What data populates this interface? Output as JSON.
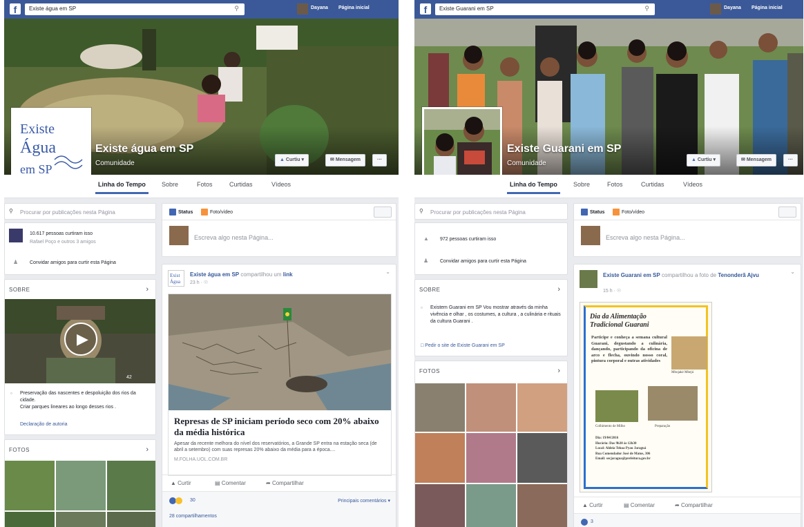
{
  "left": {
    "search_value": "Existe água em SP",
    "user_name": "Dayana",
    "home_label": "Página inicial",
    "page_name": "Existe água em SP",
    "category": "Comunidade",
    "logo_text": "Existe Água em SP",
    "like_button": "Curtiu ▾",
    "message_button": "Mensagem",
    "more_button": "···",
    "tabs": [
      "Linha do Tempo",
      "Sobre",
      "Fotos",
      "Curtidas",
      "Vídeos"
    ],
    "search_posts_placeholder": "Procurar por publicações nesta Página",
    "likes_count": "10.617 pessoas curtiram isso",
    "likes_friends": "Rafael Poço e outros 3 amigos",
    "invite_text": "Convidar amigos para curtir esta Página",
    "about_header": "SOBRE",
    "video_views": "42",
    "about_text_1": "Preservação das nascentes e despoluição dos rios da cidade.",
    "about_text_2": "Criar parques lineares ao longo desses rios .",
    "declaration_link": "Declaração de autoria",
    "photos_header": "FOTOS",
    "composer_status": "Status",
    "composer_photo": "Foto/vídeo",
    "composer_placeholder": "Escreva algo nesta Página...",
    "post_author": "Existe água em SP",
    "post_action": "compartilhou um",
    "post_link_word": "link",
    "post_time": "23 h · ",
    "article_title": "Represas de SP iniciam período seco com 20% abaixo da média histórica",
    "article_desc": "Apesar da recente melhora do nível dos reservatórios, a Grande SP entra na estação seca (de abril a setembro) com suas represas 20% abaixo da média para a época....",
    "article_source": "M.FOLHA.UOL.COM.BR",
    "like_action": "Curtir",
    "comment_action": "Comentar",
    "share_action": "Compartilhar",
    "reactions_count": "30",
    "top_comments": "Principais comentários ▾",
    "shares_count": "28 compartilhamentos"
  },
  "right": {
    "search_value": "Existe Guarani em SP",
    "user_name": "Dayana",
    "home_label": "Página inicial",
    "page_name": "Existe Guarani em SP",
    "category": "Comunidade",
    "like_button": "Curtiu ▾",
    "message_button": "Mensagem",
    "more_button": "···",
    "tabs": [
      "Linha do Tempo",
      "Sobre",
      "Fotos",
      "Curtidas",
      "Vídeos"
    ],
    "search_posts_placeholder": "Procurar por publicações nesta Página",
    "likes_count": "972 pessoas curtiram isso",
    "invite_text": "Convidar amigos para curtir esta Página",
    "about_header": "SOBRE",
    "about_text": "Existem Guarani em SP Vou mostrar através da minha vivência e olhar , os costumes, a cultura , a culinária e rituais da cultura Guarani .",
    "suggest_link": "Pedir o site de Existe Guarani em SP",
    "photos_header": "FOTOS",
    "composer_status": "Status",
    "composer_photo": "Foto/vídeo",
    "composer_placeholder": "Escreva algo nesta Página...",
    "post_author": "Existe Guarani em SP",
    "post_action": "compartilhou a foto de",
    "post_source_name": "Tenonderã Ajvu",
    "post_time": "15 h · ",
    "poster": {
      "title_line1": "Dia da Alimentação",
      "title_line2": "Tradicional Guarani",
      "body": "Participe e conheça a semana cultural Guarani, degustando a culinária, dançando, participando da oficina de arco e flecha, ouvindo nosso coral, pintura corporal e outras atividades",
      "img1_caption": "Mbojaké Mbejú",
      "img2_caption": "Colhimento de Milho",
      "img3_caption": "Preparação",
      "info1": "Dia: 19/04/2016",
      "info2": "Horário: Das 9h30 às 12h30",
      "info3": "Local: Aldeia Tekoa Pyau Jaraguá",
      "info4": "Rua Comendador José de Matos, 306",
      "info5": "Email: secjaragua@prefeitura.gov.br"
    },
    "like_action": "Curtir",
    "comment_action": "Comentar",
    "share_action": "Compartilhar",
    "reactions_count": "3"
  }
}
